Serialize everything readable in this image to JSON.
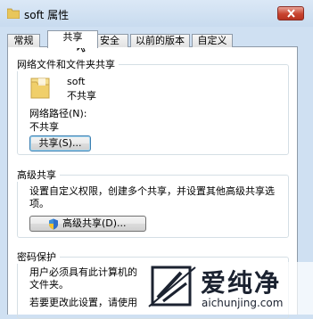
{
  "window": {
    "title": "soft 属性",
    "close_icon": "close-icon",
    "folder_icon": "folder-icon"
  },
  "tabs": [
    {
      "label": "常规",
      "active": false
    },
    {
      "label": "共享",
      "active": true
    },
    {
      "label": "安全",
      "active": false
    },
    {
      "label": "以前的版本",
      "active": false
    },
    {
      "label": "自定义",
      "active": false
    }
  ],
  "network_share": {
    "title": "网络文件和文件夹共享",
    "folder_name": "soft",
    "share_status": "不共享",
    "path_label": "网络路径(N):",
    "path_value": "不共享",
    "share_button": "共享(S)..."
  },
  "advanced_share": {
    "title": "高级共享",
    "description": "设置自定义权限，创建多个共享，并设置其他高级共享选项。",
    "desc_line1": "设置自定义权限，创建多个共享，并设置其他高级共享选",
    "desc_line2": "项。",
    "button": "高级共享(D)...",
    "shield_icon": "shield-icon"
  },
  "password": {
    "title": "密码保护",
    "line1": "用户必须具有此计算机的",
    "line2": "文件夹。",
    "line3": "若要更改此设置，请使用"
  },
  "watermark": {
    "brand": "爱纯净",
    "url": "aichunjing.com"
  }
}
